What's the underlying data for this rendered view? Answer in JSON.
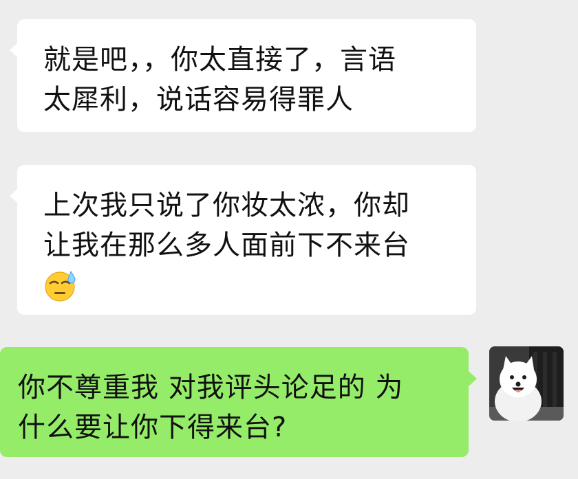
{
  "conversation": {
    "messages": [
      {
        "sender": "other",
        "lines": [
          "就是吧，，你太直接了，言语",
          "太犀利，说话容易得罪人"
        ]
      },
      {
        "sender": "other",
        "lines": [
          "上次我只说了你妆太浓，你却",
          "让我在那么多人面前下不来台"
        ],
        "emoji": "sweat-face-emoji"
      },
      {
        "sender": "self",
        "lines": [
          "你不尊重我 对我评头论足的 为",
          "什么要让你下得来台?"
        ]
      }
    ],
    "self_avatar": "samoyed-dog-avatar"
  },
  "colors": {
    "background": "#ededed",
    "incoming_bubble": "#ffffff",
    "outgoing_bubble": "#95ec69",
    "text": "#111111"
  }
}
